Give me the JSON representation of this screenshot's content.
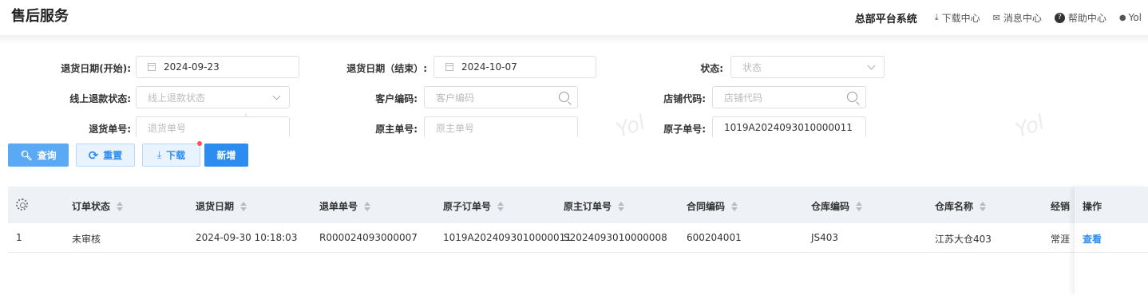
{
  "header": {
    "title": "售后服务",
    "system_name": "总部平台系统",
    "download_center": "下载中心",
    "message_center": "消息中心",
    "help_center": "帮助中心",
    "user": "Yol"
  },
  "filters": {
    "return_date_start": {
      "label": "退货日期(开始):",
      "value": "2024-09-23"
    },
    "return_date_end": {
      "label": "退货日期（结束）:",
      "value": "2024-10-07"
    },
    "status": {
      "label": "状态:",
      "placeholder": "状态"
    },
    "online_refund_status": {
      "label": "线上退款状态:",
      "placeholder": "线上退款状态"
    },
    "customer_code": {
      "label": "客户编码:",
      "placeholder": "客户编码"
    },
    "store_code": {
      "label": "店铺代码:",
      "placeholder": "店铺代码"
    },
    "return_no": {
      "label": "退货单号:",
      "placeholder": "退货单号"
    },
    "original_main_no": {
      "label": "原主单号:",
      "placeholder": "原主单号"
    },
    "original_sub_no": {
      "label": "原子单号:",
      "value": "1019A2024093010000011"
    }
  },
  "watermark": "Yol",
  "actions": {
    "query": "查询",
    "reset": "重置",
    "download": "下载",
    "add": "新增"
  },
  "table": {
    "columns": [
      "订单状态",
      "退货日期",
      "退单单号",
      "原子订单号",
      "原主订单号",
      "合同编码",
      "仓库编码",
      "仓库名称",
      "经销"
    ],
    "ops_header": "操作",
    "rows": [
      {
        "index": "1",
        "status": "未审核",
        "return_date": "2024-09-30 10:18:03",
        "return_no": "R000024093000007",
        "sub_order_no": "1019A2024093010000011",
        "main_order_no": "S2024093010000008",
        "contract_code": "600204001",
        "warehouse_code": "JS403",
        "warehouse_name": "江苏大仓403",
        "dealer": "常涯",
        "view": "查看"
      }
    ]
  }
}
